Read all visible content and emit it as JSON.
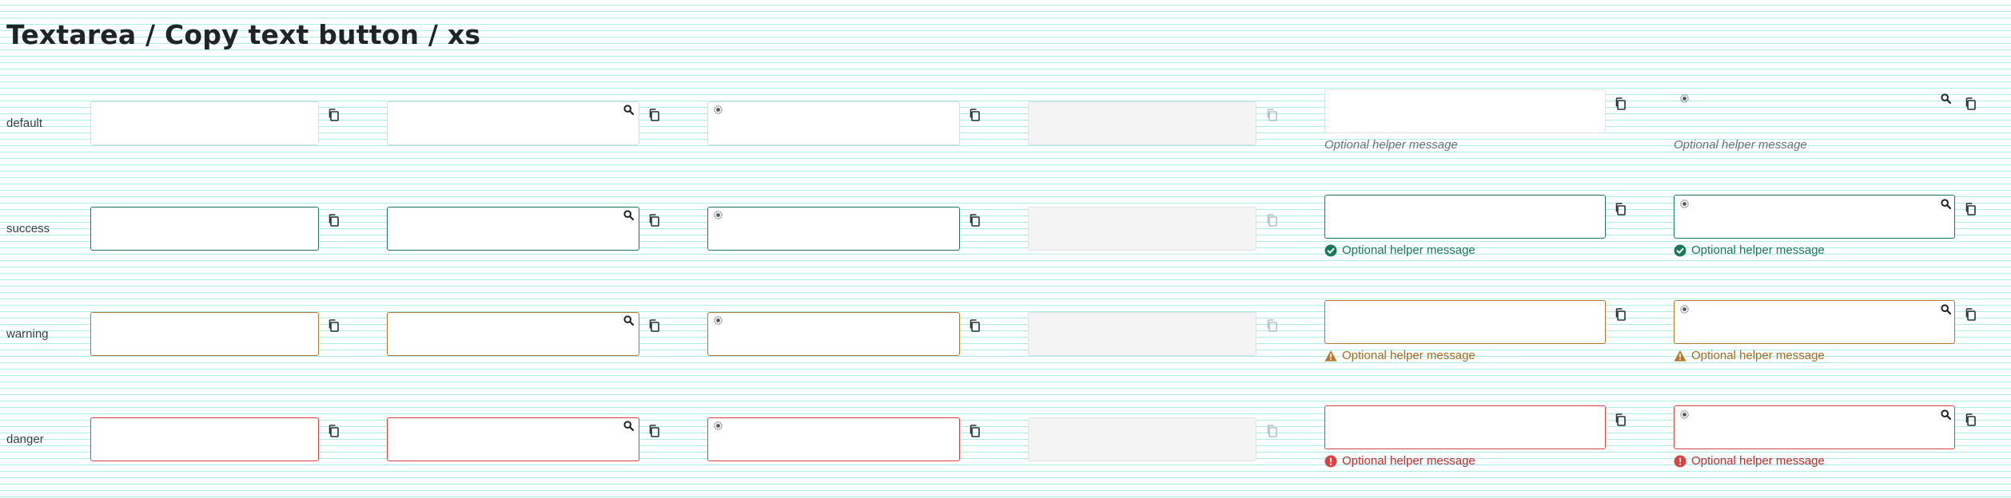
{
  "page": {
    "title": "Textarea / Copy text button / xs"
  },
  "rows": [
    {
      "state": "default",
      "label": "default"
    },
    {
      "state": "success",
      "label": "success"
    },
    {
      "state": "warning",
      "label": "warning"
    },
    {
      "state": "danger",
      "label": "danger"
    }
  ],
  "helper_text": "Optional helper message",
  "icons": {
    "copy": "copy-icon",
    "search": "search-icon",
    "leading": "sun-icon",
    "success": "check-circle-icon",
    "warning": "warning-triangle-icon",
    "danger": "error-circle-icon"
  },
  "colors": {
    "default_border": "#d6dbe0",
    "success": "#1a7a55",
    "warning": "#b8772a",
    "danger": "#d94343",
    "disabled_bg": "#f4f4f4",
    "grid_line": "#a8ecf0"
  }
}
